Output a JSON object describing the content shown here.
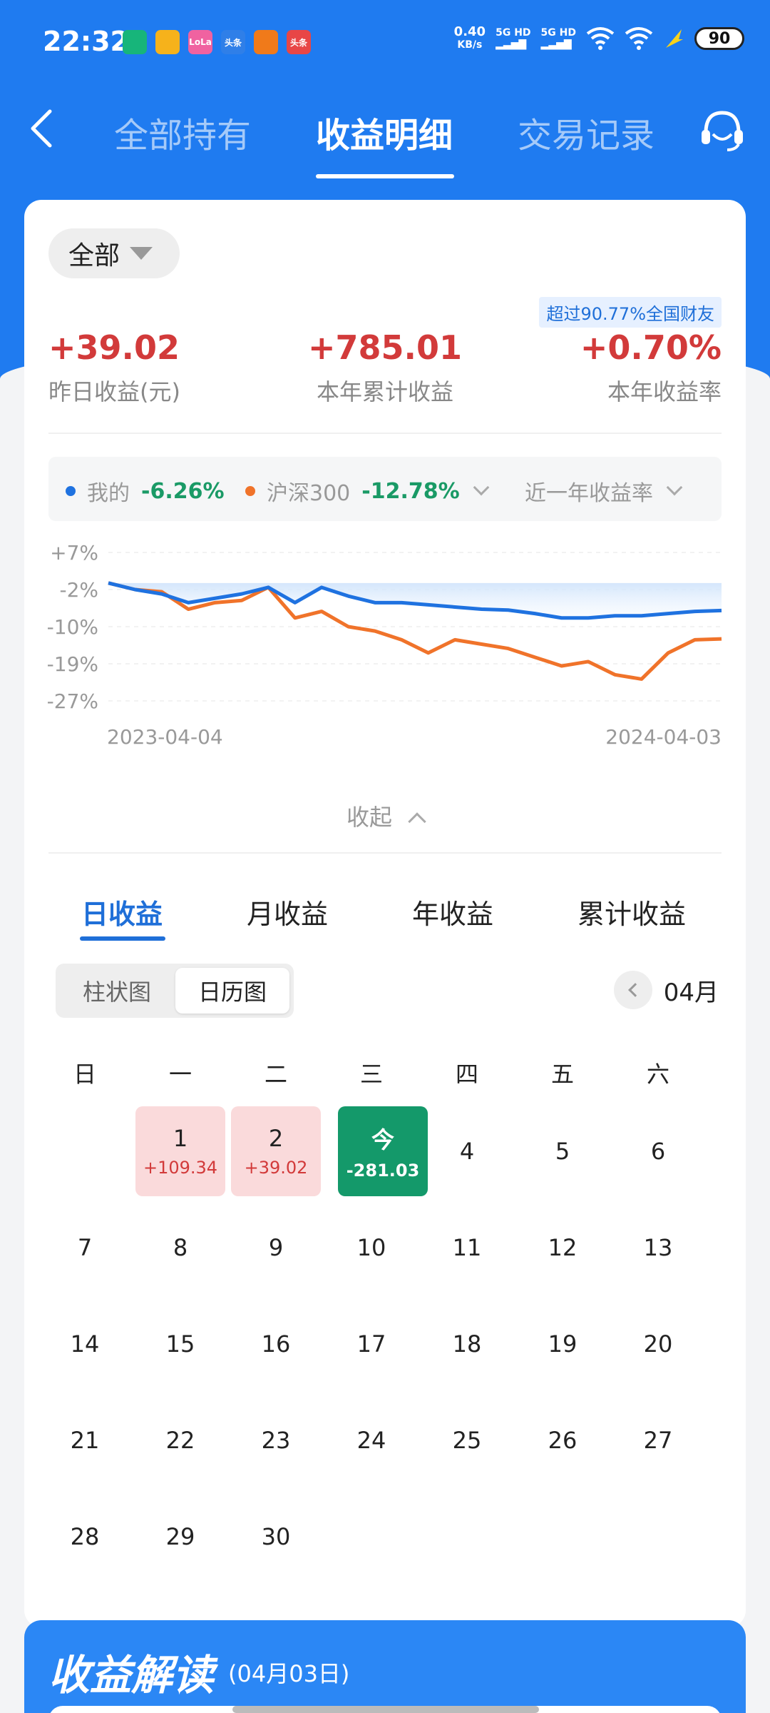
{
  "status_bar": {
    "time": "22:32",
    "speed_value": "0.40",
    "speed_unit": "KB/s",
    "sig1": "5G HD",
    "sig2": "5G HD",
    "battery": "90",
    "app_icons": [
      {
        "name": "shield-app-icon",
        "color": "#17b57a",
        "label": ""
      },
      {
        "name": "emoji-app-icon",
        "color": "#f6b21b",
        "label": ""
      },
      {
        "name": "pink-app-icon",
        "color": "#f062a0",
        "label": "LoLa"
      },
      {
        "name": "toutiao-app-icon",
        "color": "#2f7fe8",
        "label": "头条"
      },
      {
        "name": "orange-app-icon",
        "color": "#f07a1a",
        "label": ""
      },
      {
        "name": "toutiao-red-app-icon",
        "color": "#e84646",
        "label": "头条"
      }
    ]
  },
  "nav": {
    "tabs": [
      "全部持有",
      "收益明细",
      "交易记录"
    ],
    "active": 1
  },
  "filter": {
    "label": "全部"
  },
  "badge": "超过90.77%全国财友",
  "stats": [
    {
      "value": "+39.02",
      "label": "昨日收益(元)"
    },
    {
      "value": "+785.01",
      "label": "本年累计收益"
    },
    {
      "value": "+0.70%",
      "label": "本年收益率"
    }
  ],
  "legend": {
    "mine_label": "我的",
    "mine_value": "-6.26%",
    "index_label": "沪深300",
    "index_value": "-12.78%",
    "range_label": "近一年收益率"
  },
  "chart_data": {
    "type": "line",
    "x": [
      "2023-04-04",
      "2023-04-20",
      "2023-05-06",
      "2023-05-22",
      "2023-06-07",
      "2023-06-23",
      "2023-07-09",
      "2023-07-25",
      "2023-08-10",
      "2023-08-26",
      "2023-09-11",
      "2023-09-27",
      "2023-10-13",
      "2023-10-29",
      "2023-11-14",
      "2023-11-30",
      "2023-12-16",
      "2024-01-01",
      "2024-01-17",
      "2024-02-02",
      "2024-02-18",
      "2024-03-05",
      "2024-03-21",
      "2024-04-03"
    ],
    "series": [
      {
        "name": "我的",
        "color": "#1f72e0",
        "values": [
          0,
          -1.5,
          -2.5,
          -4.5,
          -3.5,
          -2.5,
          -1,
          -4.5,
          -1,
          -3,
          -4.5,
          -4.5,
          -5,
          -5.5,
          -6,
          -6.2,
          -7,
          -8,
          -8,
          -7.5,
          -7.5,
          -7,
          -6.5,
          -6.3
        ]
      },
      {
        "name": "沪深300",
        "color": "#f0732a",
        "values": [
          0,
          -1.5,
          -2,
          -6,
          -4.5,
          -4,
          -1,
          -8,
          -6.5,
          -10,
          -11,
          -13,
          -16,
          -13,
          -14,
          -15,
          -17,
          -19,
          -18,
          -21,
          -22,
          -16,
          -13,
          -12.8
        ]
      }
    ],
    "y_ticks": [
      "+7%",
      "-2%",
      "-10%",
      "-19%",
      "-27%"
    ],
    "ylim": [
      -27,
      7
    ],
    "x_start_label": "2023-04-04",
    "x_end_label": "2024-04-03",
    "grid": true
  },
  "collapse_label": "收起",
  "period_tabs": [
    "日收益",
    "月收益",
    "年收益",
    "累计收益"
  ],
  "view_toggle": [
    "柱状图",
    "日历图"
  ],
  "month": "04月",
  "weekdays": [
    "日",
    "一",
    "二",
    "三",
    "四",
    "五",
    "六"
  ],
  "calendar": [
    {
      "day": "1",
      "pnl": "+109.34",
      "style": "red"
    },
    {
      "day": "2",
      "pnl": "+39.02",
      "style": "red"
    },
    {
      "day": "今",
      "pnl": "-281.03",
      "style": "green"
    },
    {
      "day": "4"
    },
    {
      "day": "5"
    },
    {
      "day": "6"
    },
    {
      "day": "7"
    },
    {
      "day": "8"
    },
    {
      "day": "9"
    },
    {
      "day": "10"
    },
    {
      "day": "11"
    },
    {
      "day": "12"
    },
    {
      "day": "13"
    },
    {
      "day": "14"
    },
    {
      "day": "15"
    },
    {
      "day": "16"
    },
    {
      "day": "17"
    },
    {
      "day": "18"
    },
    {
      "day": "19"
    },
    {
      "day": "20"
    },
    {
      "day": "21"
    },
    {
      "day": "22"
    },
    {
      "day": "23"
    },
    {
      "day": "24"
    },
    {
      "day": "25"
    },
    {
      "day": "26"
    },
    {
      "day": "27"
    },
    {
      "day": "28"
    },
    {
      "day": "29"
    },
    {
      "day": "30"
    }
  ],
  "bottom": {
    "title": "收益解读",
    "date": "(04月03日)"
  }
}
